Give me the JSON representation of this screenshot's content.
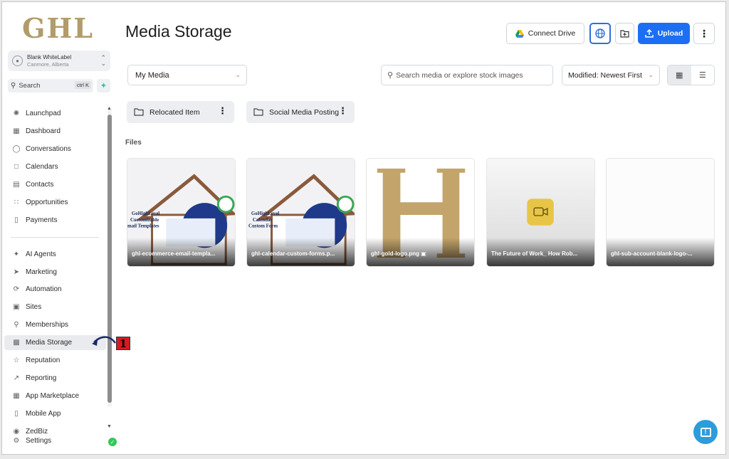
{
  "logo_text": "GHL",
  "account": {
    "name": "Blank WhiteLabel",
    "location": "Canmore, Alberta"
  },
  "search": {
    "label": "Search",
    "shortcut": "ctrl K"
  },
  "nav_top": [
    {
      "label": "Launchpad",
      "icon": "rocket-icon"
    },
    {
      "label": "Dashboard",
      "icon": "grid-icon"
    },
    {
      "label": "Conversations",
      "icon": "chat-icon"
    },
    {
      "label": "Calendars",
      "icon": "calendar-icon"
    },
    {
      "label": "Contacts",
      "icon": "contact-card-icon"
    },
    {
      "label": "Opportunities",
      "icon": "funnel-icon"
    },
    {
      "label": "Payments",
      "icon": "receipt-icon"
    }
  ],
  "nav_bottom": [
    {
      "label": "AI Agents",
      "icon": "sparkle-icon"
    },
    {
      "label": "Marketing",
      "icon": "send-icon"
    },
    {
      "label": "Automation",
      "icon": "automation-icon"
    },
    {
      "label": "Sites",
      "icon": "globe-icon"
    },
    {
      "label": "Memberships",
      "icon": "badge-icon"
    },
    {
      "label": "Media Storage",
      "icon": "image-icon",
      "active": true
    },
    {
      "label": "Reputation",
      "icon": "star-icon"
    },
    {
      "label": "Reporting",
      "icon": "trend-icon"
    },
    {
      "label": "App Marketplace",
      "icon": "apps-icon"
    },
    {
      "label": "Mobile App",
      "icon": "phone-icon"
    },
    {
      "label": "ZedBiz",
      "icon": "zedbiz-icon"
    },
    {
      "label": "Settings",
      "icon": "gear-icon"
    }
  ],
  "annotation_badge": "1",
  "page_title": "Media Storage",
  "toolbar": {
    "connect_drive": "Connect Drive",
    "upload": "Upload"
  },
  "filters": {
    "media_select": "My Media",
    "search_placeholder": "Search media or explore stock images",
    "sort_select": "Modified: Newest First"
  },
  "folders": [
    {
      "name": "Relocated Item"
    },
    {
      "name": "Social Media Posting"
    }
  ],
  "files_label": "Files",
  "files": [
    {
      "name": "ghl-ecommerce-email-templa..."
    },
    {
      "name": "ghl-calendar-custom-forms.p..."
    },
    {
      "name": "ghl-gold-logo.png"
    },
    {
      "name": "The Future of Work_ How Rob..."
    },
    {
      "name": "ghl-sub-account-blank-logo-..."
    }
  ],
  "colors": {
    "accent": "#1c6ff2",
    "logo_gold": "#b29b6c",
    "annotation_red": "#d71921",
    "help_blue": "#2d9cdb"
  }
}
